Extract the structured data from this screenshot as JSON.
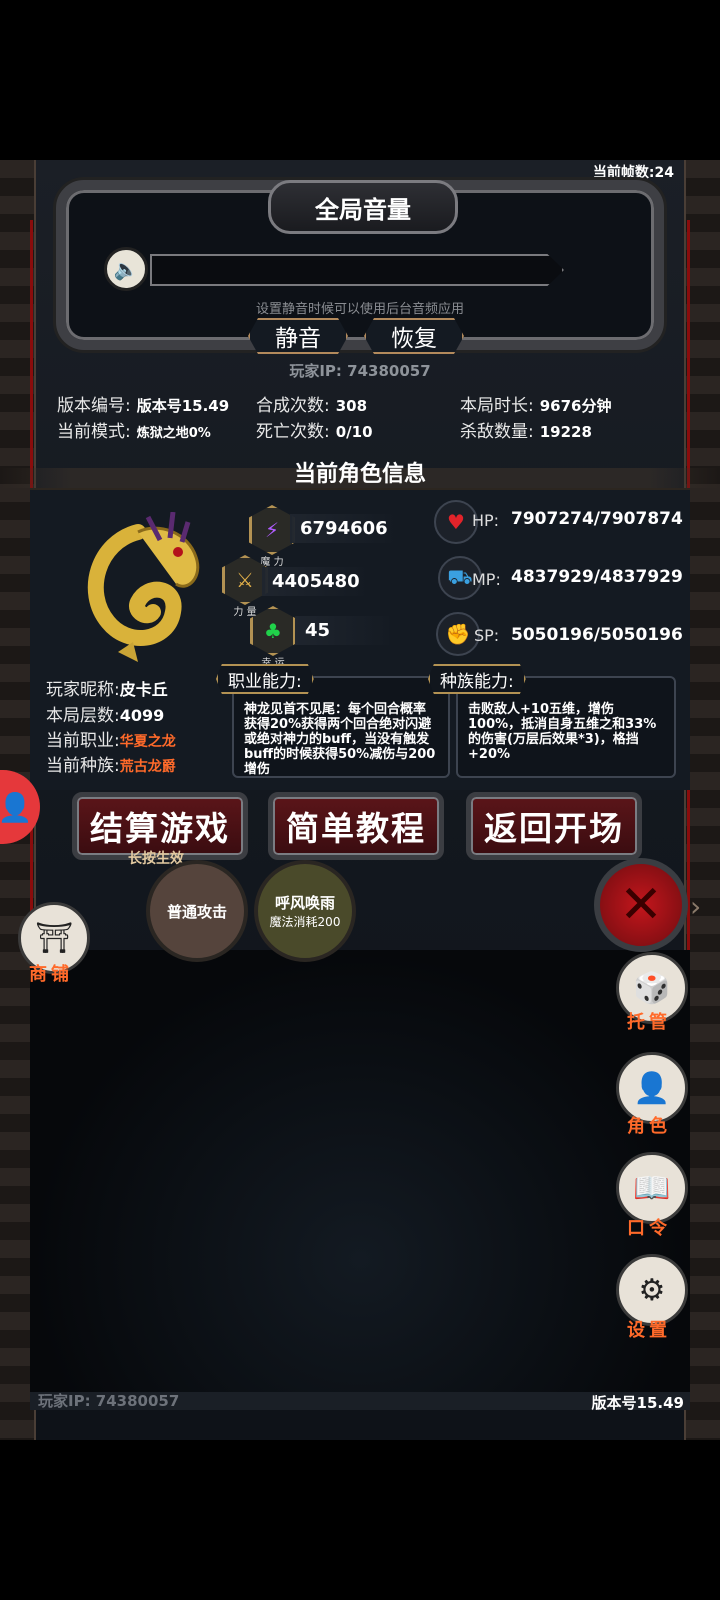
{
  "hud": {
    "fps_label": "当前帧数:24",
    "version_footer": "版本号15.49",
    "ip_footer": "玩家IP:  74380057"
  },
  "volume": {
    "title": "全局音量",
    "hint": "设置静音时候可以使用后台音频应用",
    "mute_label": "静音",
    "restore_label": "恢复",
    "player_ip": "玩家IP:  74380057"
  },
  "stats": {
    "version": {
      "label": "版本编号:",
      "value": "版本号15.49"
    },
    "mode": {
      "label": "当前模式:",
      "value": "炼狱之地0%"
    },
    "merge": {
      "label": "合成次数:",
      "value": "308"
    },
    "death": {
      "label": "死亡次数:",
      "value": "0/10"
    },
    "duration": {
      "label": "本局时长:",
      "value": "9676分钟"
    },
    "kills": {
      "label": "杀敌数量:",
      "value": "19228"
    }
  },
  "character": {
    "section_title": "当前角色信息",
    "attributes": [
      {
        "icon": "lightning-icon",
        "caption": "魔 力",
        "value": "6794606"
      },
      {
        "icon": "sword-icon",
        "caption": "力 量",
        "value": "4405480"
      },
      {
        "icon": "clover-icon",
        "caption": "幸 运",
        "value": "45"
      }
    ],
    "resources": [
      {
        "icon": "heart-icon",
        "label": "HP:",
        "value": "7907274/7907874"
      },
      {
        "icon": "mana-icon",
        "label": "MP:",
        "value": "4837929/4837929"
      },
      {
        "icon": "strength-icon",
        "label": "SP:",
        "value": "5050196/5050196"
      }
    ],
    "info": {
      "nickname": {
        "label": "玩家昵称:",
        "value": "皮卡丘"
      },
      "floor": {
        "label": "本局层数:",
        "value": "4099"
      },
      "job": {
        "label": "当前职业:",
        "value": "华夏之龙"
      },
      "race": {
        "label": "当前种族:",
        "value": "荒古龙爵"
      }
    },
    "job_ability": {
      "tag": "职业能力:",
      "text": "神龙见首不见尾：每个回合概率获得20%获得两个回合绝对闪避或绝对神力的buff，当没有触发buff的时候获得50%减伤与200增伤"
    },
    "race_ability": {
      "tag": "种族能力:",
      "text": "击败敌人+10五维，增伤100%，抵消自身五维之和33%的伤害(万层后效果*3)，格挡+20%"
    }
  },
  "actions": {
    "settle": "结算游戏",
    "settle_hint": "长按生效",
    "tutorial": "简单教程",
    "back": "返回开场"
  },
  "skills": [
    {
      "name": "普通攻击",
      "sub": ""
    },
    {
      "name": "呼风唤雨",
      "sub": "魔法消耗200"
    }
  ],
  "side_menu": {
    "shop": "商铺",
    "auto": "托管",
    "role": "角色",
    "code": "口令",
    "settings": "设置"
  },
  "colors": {
    "accent_orange": "#ff6a2a",
    "button_red": "#5b1519",
    "gold_border": "#b39253"
  }
}
